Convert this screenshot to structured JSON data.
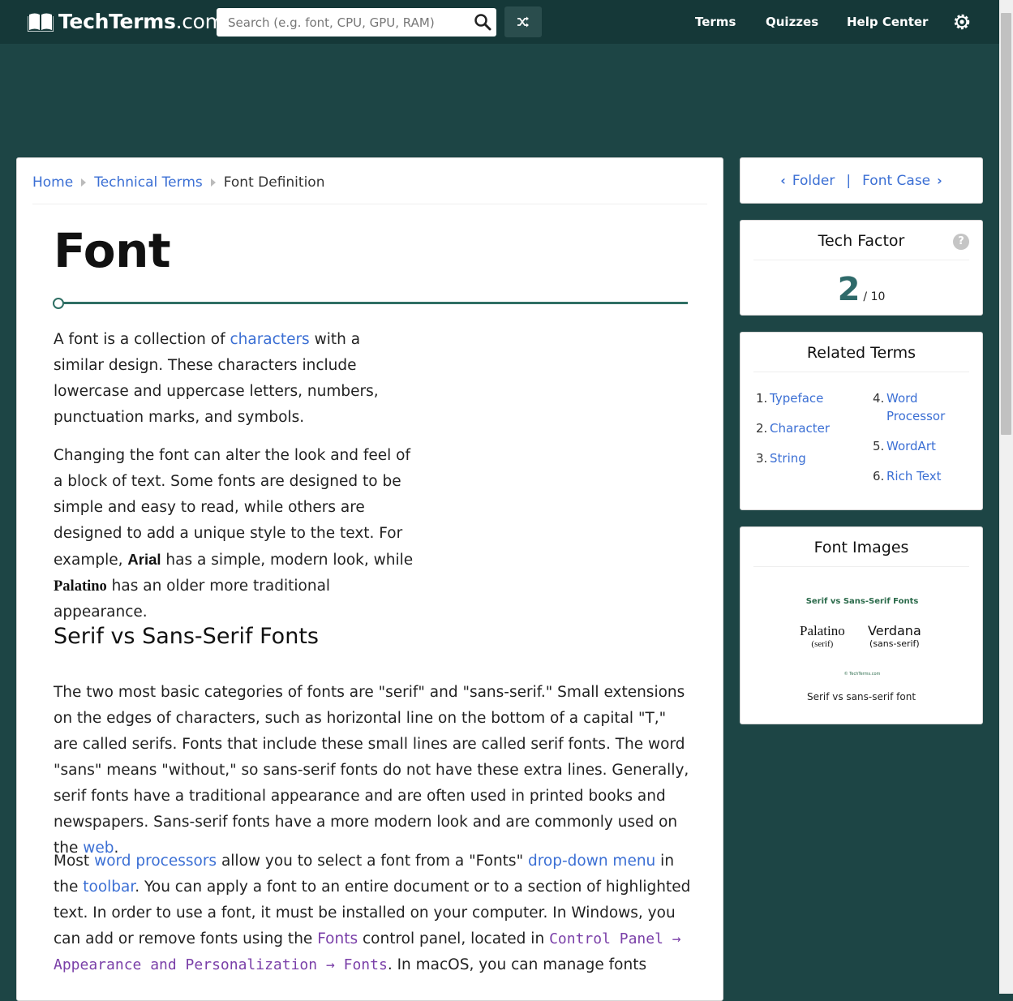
{
  "header": {
    "logo_main": "TechTerms",
    "logo_domain": ".com",
    "search_placeholder": "Search (e.g. font, CPU, GPU, RAM)",
    "nav": [
      "Terms",
      "Quizzes",
      "Help Center"
    ]
  },
  "breadcrumb": {
    "home": "Home",
    "section": "Technical Terms",
    "current": "Font Definition"
  },
  "article": {
    "title": "Font",
    "p1": {
      "t1": "A font is a collection of ",
      "link": "characters",
      "t2": " with a similar design. These characters include lowercase and uppercase letters, numbers, punctuation marks, and symbols."
    },
    "p2": {
      "t1": "Changing the font can alter the look and feel of a block of text. Some fonts are designed to be simple and easy to read, while others are designed to add a unique style to the text. For example, ",
      "arial": "Arial",
      "t2": " has a simple, modern look, while ",
      "palatino": "Palatino",
      "t3": " has an older more traditional appearance."
    },
    "h2": "Serif vs Sans-Serif Fonts",
    "p3": {
      "t1": "The two most basic categories of fonts are \"serif\" and \"sans-serif.\" Small extensions on the edges of characters, such as horizontal line on the bottom of a capital \"T,\" are called serifs. Fonts that include these small lines are called serif fonts. The word \"sans\" means \"without,\" so sans-serif fonts do not have these extra lines. Generally, serif fonts have a traditional appearance and are often used in printed books and newspapers. Sans-serif fonts have a more modern look and are commonly used on the ",
      "link": "web",
      "t2": "."
    },
    "p4": {
      "t1": "Most ",
      "l1": "word processors",
      "t2": " allow you to select a font from a \"Fonts\" ",
      "l2": "drop-down menu",
      "t3": " in the ",
      "l3": "toolbar",
      "t4": ". You can apply a font to an entire document or to a section of highlighted text. In order to use a font, it must be installed on your computer. In Windows, you can add or remove fonts using the ",
      "fonts": "Fonts",
      "t5": " control panel, located in ",
      "path": "Control Panel → Appearance and Personalization → Fonts",
      "t6": ". In macOS, you can manage fonts"
    }
  },
  "prevnext": {
    "prev": "Folder",
    "next": "Font Case"
  },
  "tech_factor": {
    "title": "Tech Factor",
    "help": "?",
    "score": "2",
    "denominator": "/ 10"
  },
  "related": {
    "title": "Related Terms",
    "items": [
      {
        "n": "1.",
        "label": "Typeface"
      },
      {
        "n": "2.",
        "label": "Character"
      },
      {
        "n": "3.",
        "label": "String"
      },
      {
        "n": "4.",
        "label": "Word Processor"
      },
      {
        "n": "5.",
        "label": "WordArt"
      },
      {
        "n": "6.",
        "label": "Rich Text"
      }
    ]
  },
  "font_images": {
    "title": "Font Images",
    "img_title": "Serif vs Sans-Serif Fonts",
    "serif_name": "Palatino",
    "serif_sub": "(serif)",
    "sans_name": "Verdana",
    "sans_sub": "(sans-serif)",
    "copyright": "© TechTerms.com",
    "caption": "Serif vs sans-serif font"
  },
  "colors": {
    "header": "#153838",
    "page_bg": "#1d4545",
    "link": "#3b6fd4",
    "accent": "#2f6f64"
  }
}
